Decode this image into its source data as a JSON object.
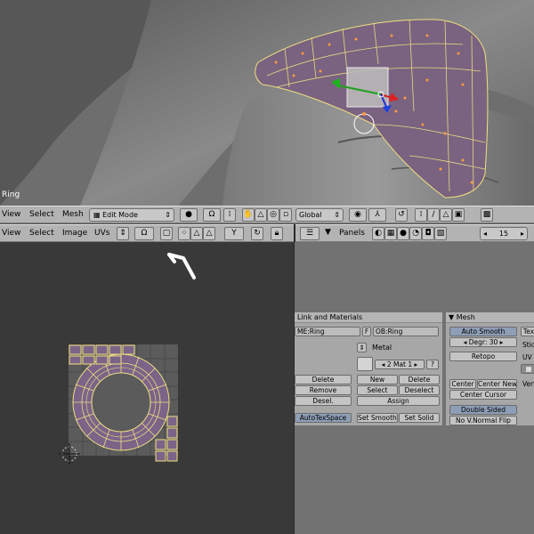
{
  "viewport3d": {
    "object_label": "Ring"
  },
  "header3d": {
    "menus": [
      "View",
      "Select",
      "Mesh"
    ],
    "mode": "Edit Mode",
    "orientation": "Global"
  },
  "uv_header": {
    "menus": [
      "View",
      "Select",
      "Image",
      "UVs"
    ]
  },
  "buttons_header": {
    "panels_label": "Panels",
    "frame": "15"
  },
  "link_materials": {
    "title": "Link and Materials",
    "mesh_field": "ME:Ring",
    "f_label": "F",
    "object_field": "OB:Ring",
    "material_name": "Metal",
    "mat_counter": "2 Mat 1",
    "help": "?",
    "vgroup_buttons": [
      "Delete",
      "Remove",
      "Desel."
    ],
    "mat_buttons": [
      "New",
      "Delete",
      "Select",
      "Deselect",
      "Assign"
    ],
    "autotex": "AutoTexSpace",
    "set_smooth": "Set Smooth",
    "set_solid": "Set Solid"
  },
  "mesh_panel": {
    "title": "Mesh",
    "auto_smooth": "Auto Smooth",
    "degr": "Degr: 30",
    "retopo": "Retopo",
    "center": "Center",
    "center_new": "Center New",
    "center_cursor": "Center Cursor",
    "double_sided": "Double Sided",
    "no_vnormal_flip": "No V.Normal Flip",
    "cut_labels": [
      "Tex",
      "Stic",
      "UV",
      "Vert"
    ]
  }
}
